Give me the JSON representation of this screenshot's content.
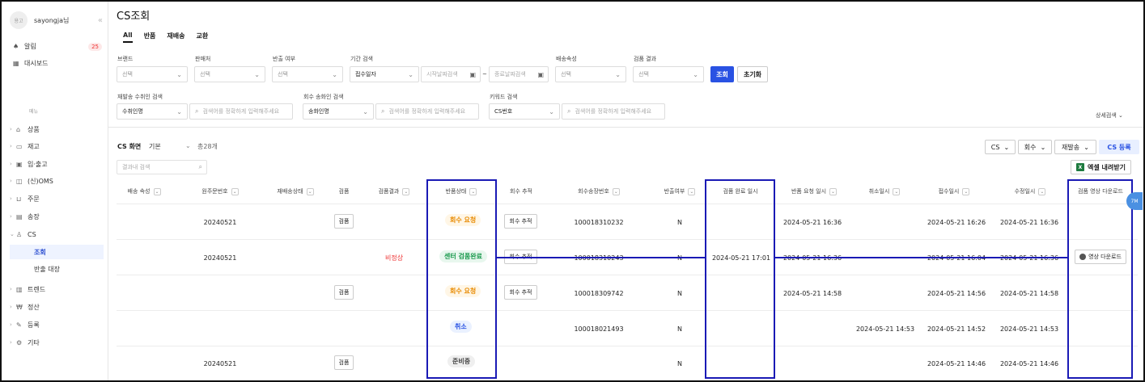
{
  "sidebar": {
    "avatar": "용고",
    "user": "sayongja님",
    "collapse": "«",
    "alarm": "알림",
    "alarm_count": "25",
    "dashboard": "대시보드",
    "menu_caption": "메뉴",
    "nav": [
      "상품",
      "재고",
      "입·출고",
      "(신)OMS",
      "주문",
      "송장",
      "CS",
      "트렌드",
      "정산",
      "등록",
      "기타"
    ],
    "cs_sub": [
      "조회",
      "반출 대장"
    ]
  },
  "page": {
    "title": "CS조회",
    "tabs": [
      "All",
      "반품",
      "재배송",
      "교환"
    ]
  },
  "filters": {
    "brand_label": "브랜드",
    "brand_value": "선택",
    "seller_label": "판매처",
    "seller_value": "선택",
    "release_label": "반출 여부",
    "release_value": "선택",
    "period_label": "기간 검색",
    "period_value": "접수일자",
    "start_placeholder": "시작날짜검색",
    "date_sep": "~",
    "end_placeholder": "종료날짜검색",
    "ship_attr_label": "배송속성",
    "ship_attr_value": "선택",
    "inspect_label": "검품 결과",
    "inspect_value": "선택",
    "search_btn": "조회",
    "reset_btn": "초기화",
    "resend_label": "재발송 수취인 검색",
    "resend_value": "수취인명",
    "resend_placeholder": "검색어를 정확하게 입력해주세요",
    "recover_label": "회수 송화인 검색",
    "recover_value": "송화인명",
    "recover_placeholder": "검색어를 정확하게 입력해주세요",
    "keyword_label": "키워드 검색",
    "keyword_value": "CS번호",
    "keyword_placeholder": "검색어를 정확하게 입력해주세요",
    "detail_search": "상세검색"
  },
  "list": {
    "screen_label": "CS 화면",
    "screen_value": "기본",
    "total": "총28개",
    "inner_search_placeholder": "결과내 검색",
    "cs_select": "CS",
    "recover_select": "회수",
    "resend_select": "재발송",
    "cs_register": "CS 등록",
    "excel": "엑셀 내려받기",
    "columns": [
      "배송 속성",
      "원주문번호",
      "재배송상태",
      "검품",
      "검품결과",
      "반품상태",
      "회수 추적",
      "회수송장번호",
      "반출여부",
      "검품 완료 일시",
      "반품 요청 일시",
      "취소일시",
      "접수일시",
      "수정일시",
      "검품 영상 다운로드"
    ],
    "rows": [
      {
        "order": "20240521",
        "inspect": "검품",
        "result": "",
        "status": "회수 요청",
        "track": "회수 추적",
        "invoice": "100018310232",
        "release": "N",
        "done": "",
        "request": "2024-05-21 16:36",
        "cancel": "",
        "received": "2024-05-21 16:26",
        "modified": "2024-05-21 16:36",
        "video": ""
      },
      {
        "order": "20240521",
        "inspect": "",
        "result": "비정상",
        "status": "센터 검품완료",
        "track": "회수 추적",
        "invoice": "100018310243",
        "release": "N",
        "done": "2024-05-21 17:01",
        "request": "2024-05-21 16:36",
        "cancel": "",
        "received": "2024-05-21 16:04",
        "modified": "2024-05-21 16:36",
        "video": "영상 다운로드"
      },
      {
        "order": "",
        "inspect": "검품",
        "result": "",
        "status": "회수 요청",
        "track": "회수 추적",
        "invoice": "100018309742",
        "release": "N",
        "done": "",
        "request": "2024-05-21 14:58",
        "cancel": "",
        "received": "2024-05-21 14:56",
        "modified": "2024-05-21 14:58",
        "video": ""
      },
      {
        "order": "",
        "inspect": "",
        "result": "",
        "status": "취소",
        "track": "",
        "invoice": "100018021493",
        "release": "N",
        "done": "",
        "request": "",
        "cancel": "2024-05-21 14:53",
        "received": "2024-05-21 14:52",
        "modified": "2024-05-21 14:53",
        "video": ""
      },
      {
        "order": "20240521",
        "inspect": "검품",
        "result": "",
        "status": "준비중",
        "track": "",
        "invoice": "",
        "release": "N",
        "done": "",
        "request": "",
        "cancel": "",
        "received": "2024-05-21 14:46",
        "modified": "2024-05-21 14:46",
        "video": ""
      }
    ],
    "float_label": "7M"
  },
  "colors": {
    "primary": "#2952e3",
    "highlight": "#1a1ab5",
    "danger": "#e33333"
  }
}
